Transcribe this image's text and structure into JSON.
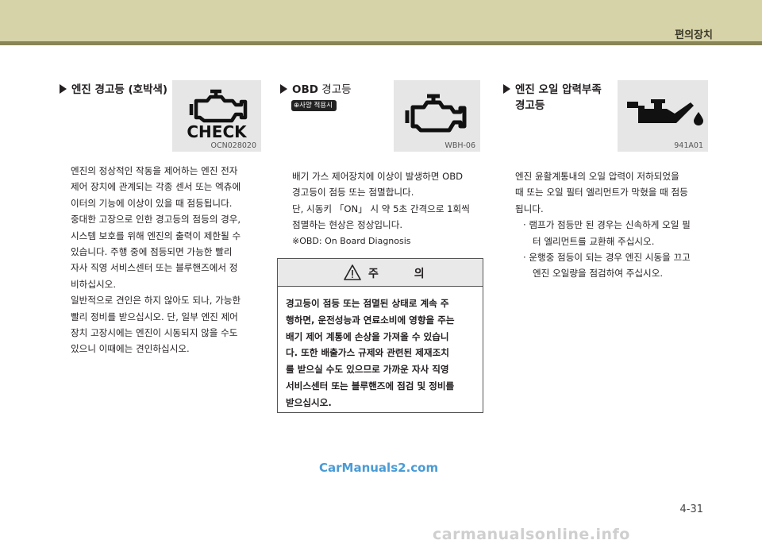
{
  "header": {
    "title": "편의장치"
  },
  "sections": [
    {
      "title": "엔진 경고등 (호박색)",
      "icon_caption": "OCN028020",
      "icon_text": "CHECK",
      "paragraphs": [
        "엔진의 정상적인 작동을 제어하는 엔진 전자",
        "제어 장치에 관계되는 각종 센서 또는 엑츄에",
        "이터의 기능에 이상이 있을 때 점등됩니다.",
        "중대한 고장으로 인한 경고등의 점등의 경우,",
        "시스템 보호를 위해 엔진의 출력이 제한될 수",
        "있습니다. 주행 중에 점등되면 가능한 빨리",
        "자사 직영 서비스센터 또는 블루핸즈에서 정",
        "비하십시오.",
        "일반적으로 견인은 하지 않아도 되나, 가능한",
        "빨리 정비를 받으십시오. 단, 일부 엔진 제어",
        "장치 고장시에는 엔진이 시동되지 않을 수도",
        "있으니 이때에는 견인하십시오."
      ]
    },
    {
      "title_bold": "OBD",
      "title_rest": " 경고등",
      "badge": "사양 적용시",
      "icon_caption": "WBH-06",
      "paragraphs": [
        "배기 가스 제어장치에 이상이 발생하면 OBD",
        "경고등이 점등 또는 점멸합니다.",
        "단, 시동키 「ON」 시 약 5초 간격으로 1회씩",
        "점멸하는 현상은 정상입니다.",
        "※OBD: On Board Diagnosis"
      ]
    },
    {
      "title_line1": "엔진 오일 압력부족",
      "title_line2": "경고등",
      "icon_caption": "941A01",
      "paragraphs": [
        "엔진 윤활계통내의 오일 압력이 저하되었을",
        "때 또는 오일 필터 엘리먼트가 막혔을 때 점등",
        "됩니다."
      ],
      "bullets": [
        [
          "· 램프가 점등만 된 경우는 신속하게 오일 필",
          "터 엘리먼트를 교환해 주십시오."
        ],
        [
          "· 운행중 점등이 되는 경우 엔진 시동을 끄고",
          "엔진 오일량을 점검하여 주십시오."
        ]
      ]
    }
  ],
  "caution": {
    "title": "주 의",
    "lines": [
      "경고등이 점등 또는 점멸된 상태로 계속 주",
      "행하면, 운전성능과 연료소비에 영향을 주는",
      "배기 제어 계통에 손상을 가져올 수 있습니",
      "다. 또한 배출가스 규제와 관련된 제재조치",
      "를 받으실 수도 있으므로 가까운 자사 직영",
      "서비스센터 또는 블루핸즈에 점검 및 정비를",
      "받으십시오."
    ]
  },
  "watermark": "CarManuals2.com",
  "page_number": "4-31",
  "footer_logo": "carmanualsonline.info"
}
